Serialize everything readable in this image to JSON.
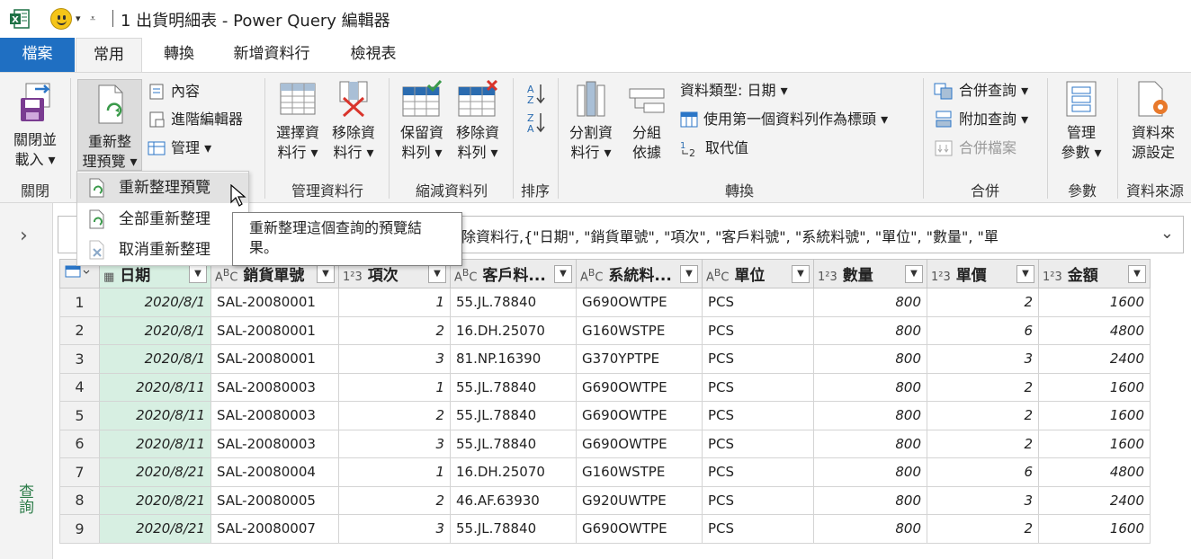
{
  "titlebar": {
    "title": "1 出貨明細表 - Power Query 編輯器",
    "excel_icon": "excel-icon",
    "feedback_icon": "smiley-icon"
  },
  "tabs": [
    "檔案",
    "常用",
    "轉換",
    "新增資料行",
    "檢視表"
  ],
  "ribbon": {
    "close_load": {
      "line1": "關閉並",
      "line2": "載入 ▾"
    },
    "group_close": "關閉",
    "refresh_preview": {
      "line1": "重新整",
      "line2": "理預覽 ▾"
    },
    "properties": "內容",
    "advanced_editor": "進階編輯器",
    "manage": "管理 ▾",
    "choose_cols": {
      "line1": "選擇資",
      "line2": "料行 ▾"
    },
    "remove_cols": {
      "line1": "移除資",
      "line2": "料行 ▾"
    },
    "group_manage_cols": "管理資料行",
    "keep_rows": {
      "line1": "保留資",
      "line2": "料列 ▾"
    },
    "remove_rows": {
      "line1": "移除資",
      "line2": "料列 ▾"
    },
    "group_reduce_rows": "縮減資料列",
    "group_sort": "排序",
    "split_col": {
      "line1": "分割資",
      "line2": "料行 ▾"
    },
    "group_by": {
      "line1": "分組",
      "line2": "依據"
    },
    "data_type": "資料類型: 日期 ▾",
    "use_first_row": "使用第一個資料列作為標頭 ▾",
    "replace_values": "取代值",
    "group_transform": "轉換",
    "merge_queries": "合併查詢 ▾",
    "append_queries": "附加查詢 ▾",
    "combine_files": "合併檔案",
    "group_combine": "合併",
    "manage_params": {
      "line1": "管理",
      "line2": "參數 ▾"
    },
    "group_params": "參數",
    "data_source": {
      "line1": "資料來",
      "line2": "源設定"
    },
    "group_data_source": "資料來源"
  },
  "menu": {
    "items": [
      "重新整理預覽",
      "全部重新整理",
      "取消重新整理"
    ]
  },
  "tooltip": "重新整理這個查詢的預覽結果。",
  "formula": "除資料行,{\"日期\", \"銷貨單號\", \"項次\", \"客戶料號\", \"系統料號\", \"單位\", \"數量\", \"單",
  "queries_label": "查詢",
  "table": {
    "columns": [
      {
        "type": "date",
        "name": "日期"
      },
      {
        "type": "ABC",
        "name": "銷貨單號"
      },
      {
        "type": "123",
        "name": "項次"
      },
      {
        "type": "ABC",
        "name": "客戶料..."
      },
      {
        "type": "ABC",
        "name": "系統料..."
      },
      {
        "type": "ABC",
        "name": "單位"
      },
      {
        "type": "123",
        "name": "數量"
      },
      {
        "type": "123",
        "name": "單價"
      },
      {
        "type": "123",
        "name": "金額"
      }
    ],
    "rows": [
      [
        "1",
        "2020/8/1",
        "SAL-20080001",
        "1",
        "55.JL.78840",
        "G690OWTPE",
        "PCS",
        "800",
        "2",
        "1600"
      ],
      [
        "2",
        "2020/8/1",
        "SAL-20080001",
        "2",
        "16.DH.25070",
        "G160WSTPE",
        "PCS",
        "800",
        "6",
        "4800"
      ],
      [
        "3",
        "2020/8/1",
        "SAL-20080001",
        "3",
        "81.NP.16390",
        "G370YPTPE",
        "PCS",
        "800",
        "3",
        "2400"
      ],
      [
        "4",
        "2020/8/11",
        "SAL-20080003",
        "1",
        "55.JL.78840",
        "G690OWTPE",
        "PCS",
        "800",
        "2",
        "1600"
      ],
      [
        "5",
        "2020/8/11",
        "SAL-20080003",
        "2",
        "55.JL.78840",
        "G690OWTPE",
        "PCS",
        "800",
        "2",
        "1600"
      ],
      [
        "6",
        "2020/8/11",
        "SAL-20080003",
        "3",
        "55.JL.78840",
        "G690OWTPE",
        "PCS",
        "800",
        "2",
        "1600"
      ],
      [
        "7",
        "2020/8/21",
        "SAL-20080004",
        "1",
        "16.DH.25070",
        "G160WSTPE",
        "PCS",
        "800",
        "6",
        "4800"
      ],
      [
        "8",
        "2020/8/21",
        "SAL-20080005",
        "2",
        "46.AF.63930",
        "G920UWTPE",
        "PCS",
        "800",
        "3",
        "2400"
      ],
      [
        "9",
        "2020/8/21",
        "SAL-20080007",
        "3",
        "55.JL.78840",
        "G690OWTPE",
        "PCS",
        "800",
        "2",
        "1600"
      ]
    ]
  },
  "colors": {
    "file_tab": "#1f6fc2",
    "date_column": "#d7efe2",
    "queries_label": "#2e7d4a"
  }
}
